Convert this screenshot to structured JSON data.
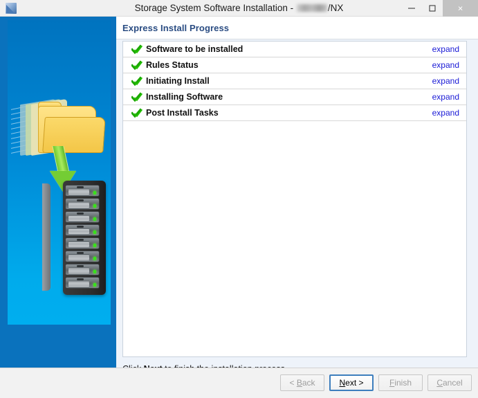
{
  "window": {
    "title_prefix": "Storage System Software Installation - ",
    "title_suffix": "/NX",
    "app_icon": "app-logo-icon",
    "controls": {
      "minimize": "minimize-icon",
      "maximize": "maximize-icon",
      "close": "×"
    }
  },
  "sidebar": {
    "graphic": "folders-to-server-rack-illustration",
    "bay_count": 8,
    "colors": {
      "panel": "#0a72bd",
      "art_top": "#0073bf",
      "art_bottom": "#00aeef",
      "folder": "#f6cf5c",
      "arrow": "#74cd34",
      "led": "#38e21a"
    }
  },
  "page": {
    "title": "Express Install Progress",
    "title_color": "#2a4c82"
  },
  "progress_list": {
    "expand_label": "expand",
    "check_icon": "green-double-check-icon",
    "items": [
      {
        "label": "Software to be installed",
        "status": "complete"
      },
      {
        "label": "Rules Status",
        "status": "complete"
      },
      {
        "label": "Initiating Install",
        "status": "complete"
      },
      {
        "label": "Installing Software",
        "status": "complete"
      },
      {
        "label": "Post Install Tasks",
        "status": "complete"
      }
    ]
  },
  "instruction": {
    "before": "Click ",
    "emphasis": "Next",
    "after": " to finish the installation process."
  },
  "footer": {
    "buttons": [
      {
        "name": "back",
        "label": "< Back",
        "accel": "B",
        "enabled": false,
        "focused": false
      },
      {
        "name": "next",
        "label": "Next >",
        "accel": "N",
        "enabled": true,
        "focused": true
      },
      {
        "name": "finish",
        "label": "Finish",
        "accel": "F",
        "enabled": false,
        "focused": false
      },
      {
        "name": "cancel",
        "label": "Cancel",
        "accel": "C",
        "enabled": false,
        "focused": false
      }
    ]
  }
}
